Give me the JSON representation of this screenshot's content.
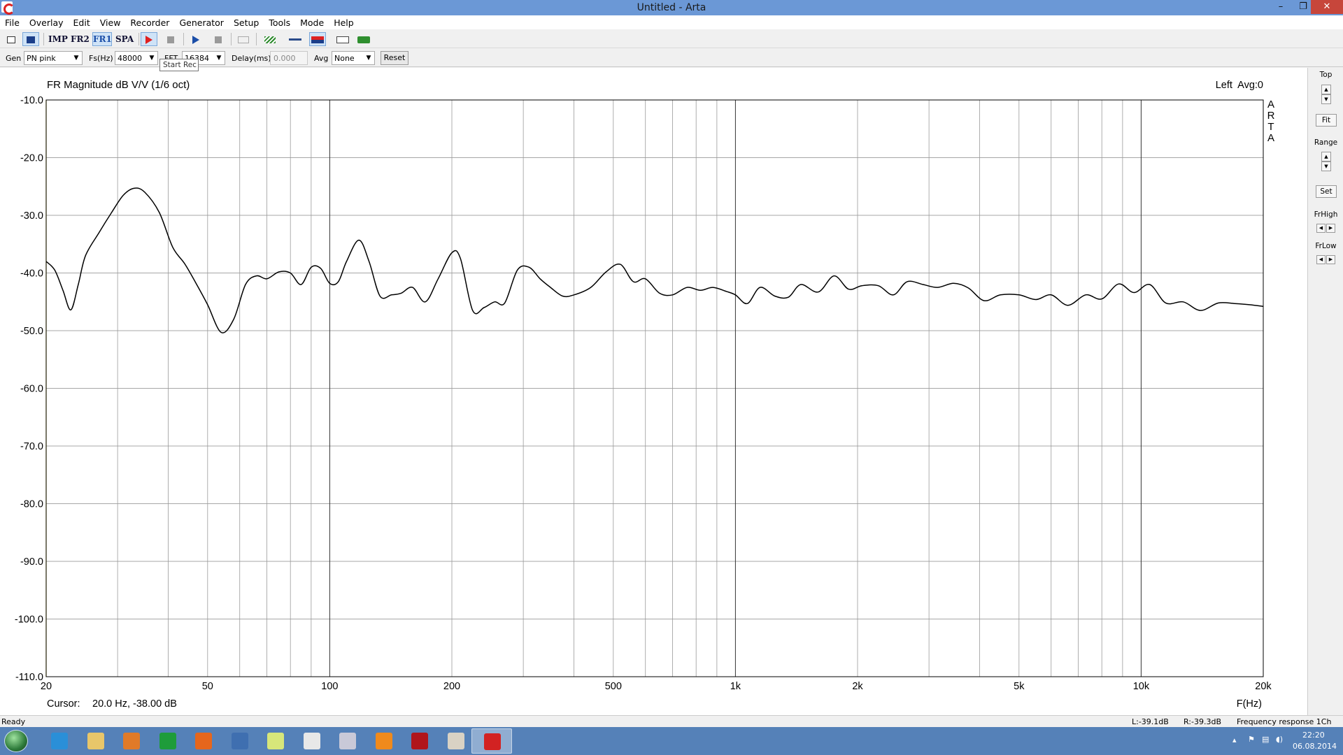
{
  "window": {
    "title": "Untitled - Arta",
    "minimize": "–",
    "restore": "❐",
    "close": "✕"
  },
  "menu": [
    "File",
    "Overlay",
    "Edit",
    "View",
    "Recorder",
    "Generator",
    "Setup",
    "Tools",
    "Mode",
    "Help"
  ],
  "toolbar": {
    "imp": "IMP",
    "fr2": "FR2",
    "fr1": "FR1",
    "spa": "SPA",
    "tooltip": "Start Rec"
  },
  "params": {
    "gen_label": "Gen",
    "gen_value": "PN pink",
    "fs_label": "Fs(Hz)",
    "fs_value": "48000",
    "fft_label": "FFT",
    "fft_value": "16384",
    "delay_label": "Delay(ms)",
    "delay_value": "0.000",
    "avg_label": "Avg",
    "avg_value": "None",
    "reset_label": "Reset"
  },
  "chart_data": {
    "type": "line",
    "title": "FR Magnitude dB V/V (1/6 oct)",
    "channel_info": "Left  Avg:0",
    "watermark": "ARTA",
    "xlabel": "F(Hz)",
    "ylabel": "",
    "x_scale": "log",
    "xlim": [
      20,
      20000
    ],
    "ylim": [
      -110,
      -10
    ],
    "y_ticks": [
      "-10.0",
      "-20.0",
      "-30.0",
      "-40.0",
      "-50.0",
      "-60.0",
      "-70.0",
      "-80.0",
      "-90.0",
      "-100.0",
      "-110.0"
    ],
    "x_ticks": [
      {
        "f": 20,
        "label": "20"
      },
      {
        "f": 50,
        "label": "50"
      },
      {
        "f": 100,
        "label": "100"
      },
      {
        "f": 200,
        "label": "200"
      },
      {
        "f": 500,
        "label": "500"
      },
      {
        "f": 1000,
        "label": "1k"
      },
      {
        "f": 2000,
        "label": "2k"
      },
      {
        "f": 5000,
        "label": "5k"
      },
      {
        "f": 10000,
        "label": "10k"
      },
      {
        "f": 20000,
        "label": "20k"
      }
    ],
    "grid": true,
    "series": [
      {
        "color": "#000000",
        "x": [
          20,
          21,
          22,
          23,
          24,
          25,
          27,
          29,
          31,
          33,
          35,
          38,
          41,
          44,
          47,
          50,
          54,
          58,
          62,
          66,
          70,
          75,
          80,
          85,
          90,
          95,
          100,
          105,
          110,
          118,
          125,
          133,
          142,
          150,
          160,
          172,
          185,
          200,
          210,
          225,
          240,
          255,
          270,
          290,
          310,
          330,
          350,
          375,
          400,
          440,
          480,
          520,
          560,
          600,
          650,
          700,
          760,
          820,
          880,
          950,
          1000,
          1070,
          1150,
          1250,
          1350,
          1450,
          1600,
          1750,
          1900,
          2050,
          2250,
          2450,
          2650,
          2900,
          3150,
          3450,
          3750,
          4100,
          4500,
          5000,
          5500,
          6000,
          6600,
          7300,
          8000,
          8800,
          9600,
          10500,
          11500,
          12700,
          14000,
          15500,
          17000,
          18500,
          20000
        ],
        "y": [
          -38,
          -39.5,
          -43,
          -46.4,
          -42,
          -37,
          -33,
          -29.5,
          -26.5,
          -25.3,
          -26,
          -29.5,
          -35.5,
          -38.5,
          -42,
          -45.5,
          -50.3,
          -48,
          -42,
          -40.5,
          -41,
          -39.8,
          -40,
          -42,
          -39,
          -39.2,
          -41.8,
          -41.5,
          -38,
          -34.3,
          -38,
          -44,
          -43.8,
          -43.5,
          -42.5,
          -45,
          -41,
          -36.5,
          -37.5,
          -46.5,
          -46,
          -45,
          -45.2,
          -39.5,
          -39,
          -41,
          -42.5,
          -44,
          -43.8,
          -42.5,
          -39.8,
          -38.5,
          -41.5,
          -41,
          -43.5,
          -43.8,
          -42.5,
          -43,
          -42.5,
          -43.2,
          -43.8,
          -45.3,
          -42.5,
          -44,
          -44.2,
          -42,
          -43.3,
          -40.5,
          -42.8,
          -42.2,
          -42.2,
          -43.8,
          -41.5,
          -42,
          -42.5,
          -41.8,
          -42.6,
          -44.8,
          -43.8,
          -43.8,
          -44.6,
          -43.8,
          -45.6,
          -43.8,
          -44.5,
          -41.9,
          -43.4,
          -42,
          -45.2,
          -45,
          -46.5,
          -45.2,
          -45.3,
          -45.5,
          -45.8
        ]
      }
    ]
  },
  "cursor": {
    "label": "Cursor:",
    "value": "20.0 Hz, -38.00 dB"
  },
  "right_panel": {
    "top_label": "Top",
    "fit_label": "Fit",
    "range_label": "Range",
    "set_label": "Set",
    "frhigh_label": "FrHigh",
    "frlow_label": "FrLow"
  },
  "statusbar": {
    "status": "Ready",
    "left_level": "L:-39.1dB",
    "right_level": "R:-39.3dB",
    "mode": "Frequency response 1Ch"
  },
  "taskbar": {
    "apps": [
      {
        "icon": "internet-explorer-icon",
        "color": "#2a8fd8",
        "active": false
      },
      {
        "icon": "file-explorer-icon",
        "color": "#e8c66a",
        "active": false
      },
      {
        "icon": "media-player-icon",
        "color": "#e07a28",
        "active": false
      },
      {
        "icon": "store-icon",
        "color": "#1e9c3a",
        "active": false
      },
      {
        "icon": "firefox-icon",
        "color": "#e6661c",
        "active": false
      },
      {
        "icon": "thunderbird-icon",
        "color": "#3f6fb0",
        "active": false
      },
      {
        "icon": "notes-icon",
        "color": "#d7e67a",
        "active": false
      },
      {
        "icon": "window-app-icon",
        "color": "#e8e8e8",
        "active": false
      },
      {
        "icon": "document-app-icon",
        "color": "#c9c9d8",
        "active": false
      },
      {
        "icon": "k-app-icon",
        "color": "#f08a1c",
        "active": false
      },
      {
        "icon": "dice-app-icon",
        "color": "#b0151c",
        "active": false
      },
      {
        "icon": "paint-app-icon",
        "color": "#d9d2c4",
        "active": false
      },
      {
        "icon": "arta-icon",
        "color": "#d22222",
        "active": true
      }
    ],
    "time": "22:20",
    "date": "06.08.2014"
  }
}
